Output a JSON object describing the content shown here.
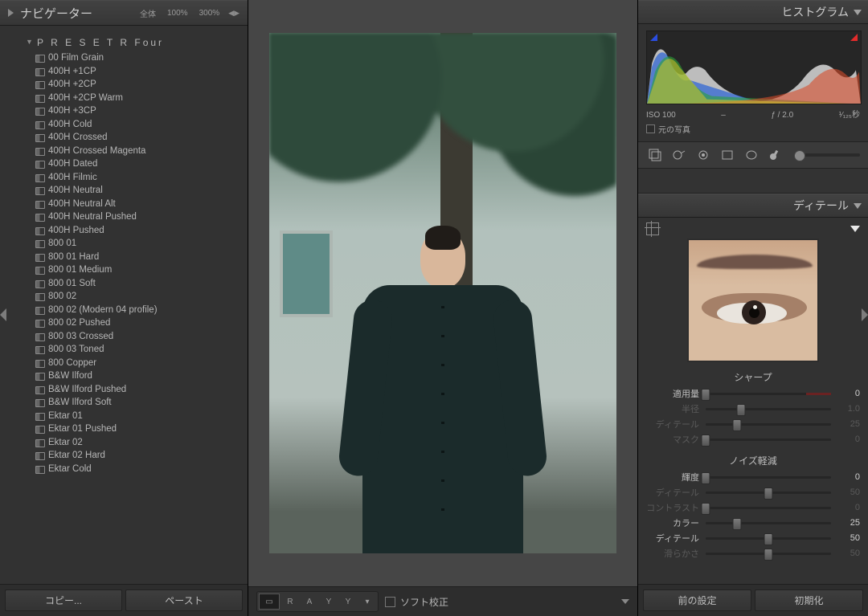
{
  "left": {
    "navigator_label": "ナビゲーター",
    "zoom_fit": "全体",
    "zoom_100": "100%",
    "zoom_300": "300%",
    "preset_folder": "P R E S E T R  Four",
    "presets": [
      "00 Film Grain",
      "400H +1CP",
      "400H +2CP",
      "400H +2CP Warm",
      "400H +3CP",
      "400H Cold",
      "400H Crossed",
      "400H Crossed Magenta",
      "400H Dated",
      "400H Filmic",
      "400H Neutral",
      "400H Neutral Alt",
      "400H Neutral Pushed",
      "400H Pushed",
      "800 01",
      "800 01 Hard",
      "800 01 Medium",
      "800 01 Soft",
      "800 02",
      "800 02 (Modern 04 profile)",
      "800 02 Pushed",
      "800 03 Crossed",
      "800 03 Toned",
      "800 Copper",
      "B&W Ilford",
      "B&W Ilford Pushed",
      "B&W Ilford Soft",
      "Ektar 01",
      "Ektar 01 Pushed",
      "Ektar 02",
      "Ektar 02 Hard",
      "Ektar Cold"
    ],
    "copy_label": "コピー...",
    "paste_label": "ペースト"
  },
  "center": {
    "compare_r": "R",
    "compare_a": "A",
    "compare_y1": "Y",
    "compare_y2": "Y",
    "softproof_label": "ソフト校正"
  },
  "right": {
    "histogram_title": "ヒストグラム",
    "iso_label": "ISO 100",
    "focal_dash": "–",
    "aperture_label": "ƒ / 2.0",
    "shutter_value": "¹⁄₁₂₅",
    "shutter_unit": "秒",
    "original_label": "元の写真",
    "detail_title": "ディテール",
    "sharpen_title": "シャープ",
    "noise_title": "ノイズ軽減",
    "sliders": {
      "amount": {
        "label": "適用量",
        "value": "0",
        "pos": 0,
        "dim": false,
        "split": true
      },
      "radius": {
        "label": "半径",
        "value": "1.0",
        "pos": 28,
        "dim": true
      },
      "detail": {
        "label": "ディテール",
        "value": "25",
        "pos": 25,
        "dim": true
      },
      "mask": {
        "label": "マスク",
        "value": "0",
        "pos": 0,
        "dim": true
      },
      "luminance": {
        "label": "輝度",
        "value": "0",
        "pos": 0,
        "dim": false
      },
      "lum_detail": {
        "label": "ディテール",
        "value": "50",
        "pos": 50,
        "dim": true
      },
      "lum_contrast": {
        "label": "コントラスト",
        "value": "0",
        "pos": 0,
        "dim": true
      },
      "color": {
        "label": "カラー",
        "value": "25",
        "pos": 25,
        "dim": false
      },
      "col_detail": {
        "label": "ディテール",
        "value": "50",
        "pos": 50,
        "dim": false
      },
      "col_smooth": {
        "label": "滑らかさ",
        "value": "50",
        "pos": 50,
        "dim": true
      }
    },
    "prev_label": "前の設定",
    "reset_label": "初期化"
  }
}
